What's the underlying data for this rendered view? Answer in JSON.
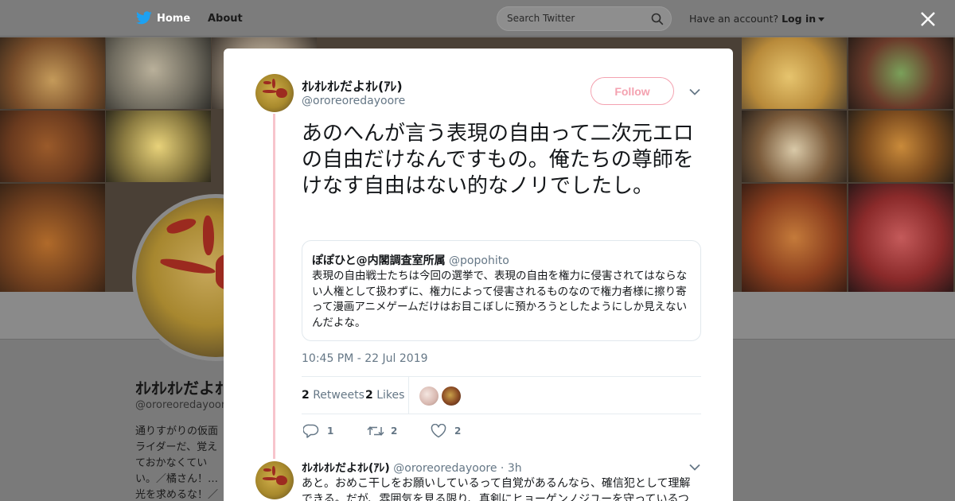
{
  "nav": {
    "home_label": "Home",
    "about_label": "About",
    "search_placeholder": "Search Twitter",
    "account_prompt": "Have an account?",
    "login_label": "Log in"
  },
  "colors": {
    "accent": "#f4a2b0",
    "thread_line": "#f7c4cc",
    "muted_text": "#657786",
    "text": "#14171a"
  },
  "profile": {
    "name": "ｵﾚｵﾚｵﾚだよｵﾚ(ｱﾚ)",
    "handle": "@ororeoredayoore",
    "bio": "通りすがりの仮面ライダーだ、覚えておかなくていい。／橘さん！…光を求めるな！／おっさん無職。即死寸前。かな…"
  },
  "tweet": {
    "name": "ｵﾚｵﾚｵﾚだよｵﾚ(ｱﾚ)",
    "handle": "@ororeoredayoore",
    "follow_label": "Follow",
    "text": "あのへんが言う表現の自由って二次元エロの自由だけなんですもの。俺たちの尊師をけなす自由はない的なノリでしたし。",
    "quote": {
      "name": "ぽぽひと@内閣調査室所属",
      "handle": "@popohito",
      "text": "表現の自由戦士たちは今回の選挙で、表現の自由を権力に侵害されてはならない人権として扱わずに、権力によって侵害されるものなので権力者様に擦り寄って漫画アニメゲームだけはお目こぼしに預かろうとしたようにしか見えないんだよな。"
    },
    "timestamp": "10:45 PM - 22 Jul 2019",
    "retweets_count": "2",
    "retweets_label": "Retweets",
    "likes_count": "2",
    "likes_label": "Likes",
    "reply_count": "1",
    "retweet_count": "2",
    "like_count": "2"
  },
  "reply": {
    "name": "ｵﾚｵﾚｵﾚだよｵﾚ(ｱﾚ)",
    "handle": "@ororeoredayoore",
    "time": "3h",
    "text": "あと。おめこ干しをお願いしているって自覚があるんなら、確信犯として理解できる。だが、雰囲気を見る限り、真剣にヒョーゲンノジユーを守っているつ"
  }
}
